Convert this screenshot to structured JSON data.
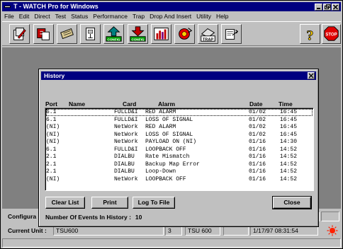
{
  "window": {
    "title": "T - WATCH Pro for Windows"
  },
  "menu": [
    "File",
    "Edit",
    "Direct",
    "Test",
    "Status",
    "Performance",
    "Trap",
    "Drop And Insert",
    "Utility",
    "Help"
  ],
  "toolbar": {
    "config1_label": "CONFIG",
    "config2_label": "CONFIG",
    "trap_label": "TRAP",
    "help_glyph": "?",
    "stop_label": "STOP"
  },
  "dialog": {
    "title": "History",
    "columns": [
      "Port",
      "Name",
      "Card",
      "Alarm",
      "Date",
      "Time"
    ],
    "rows": [
      {
        "port": "6.1",
        "name": "",
        "card": "FULLD&I",
        "alarm": "RED ALARM",
        "date": "01/02",
        "time": "16:45"
      },
      {
        "port": "6.1",
        "name": "",
        "card": "FULLD&I",
        "alarm": "LOSS OF SIGNAL",
        "date": "01/02",
        "time": "16:45"
      },
      {
        "port": "(NI)",
        "name": "",
        "card": "NetWork",
        "alarm": "RED ALARM",
        "date": "01/02",
        "time": "16:45"
      },
      {
        "port": "(NI)",
        "name": "",
        "card": "NetWork",
        "alarm": "LOSS OF SIGNAL",
        "date": "01/02",
        "time": "16:45"
      },
      {
        "port": "(NI)",
        "name": "",
        "card": "NetWork",
        "alarm": "PAYLOAD ON (NI)",
        "date": "01/16",
        "time": "14:30"
      },
      {
        "port": "6.1",
        "name": "",
        "card": "FULLD&I",
        "alarm": "LOOPBACK OFF",
        "date": "01/16",
        "time": "14:52"
      },
      {
        "port": "2.1",
        "name": "",
        "card": "DIALBU",
        "alarm": "Rate Mismatch",
        "date": "01/16",
        "time": "14:52"
      },
      {
        "port": "2.1",
        "name": "",
        "card": "DIALBU",
        "alarm": "Backup Map Error",
        "date": "01/16",
        "time": "14:52"
      },
      {
        "port": "2.1",
        "name": "",
        "card": "DIALBU",
        "alarm": "Loop-Down",
        "date": "01/16",
        "time": "14:52"
      },
      {
        "port": "(NI)",
        "name": "",
        "card": "NetWork",
        "alarm": "LOOPBACK OFF",
        "date": "01/16",
        "time": "14:52"
      }
    ],
    "buttons": {
      "clear": "Clear List",
      "print": "Print",
      "log": "Log To File",
      "close": "Close"
    },
    "events_label": "Number Of Events In History :",
    "events_count": "10"
  },
  "status": {
    "config_label": "Configura",
    "unit_label": "Current Unit :",
    "unit_value": "TSU600",
    "slot_value": "3",
    "unit_name": "TSU 600",
    "datetime": "1/17/97  08:31:54"
  },
  "colors": {
    "titlebar": "#000080",
    "face": "#c0c0c0",
    "workspace": "#808080",
    "alert": "#ff2000"
  }
}
